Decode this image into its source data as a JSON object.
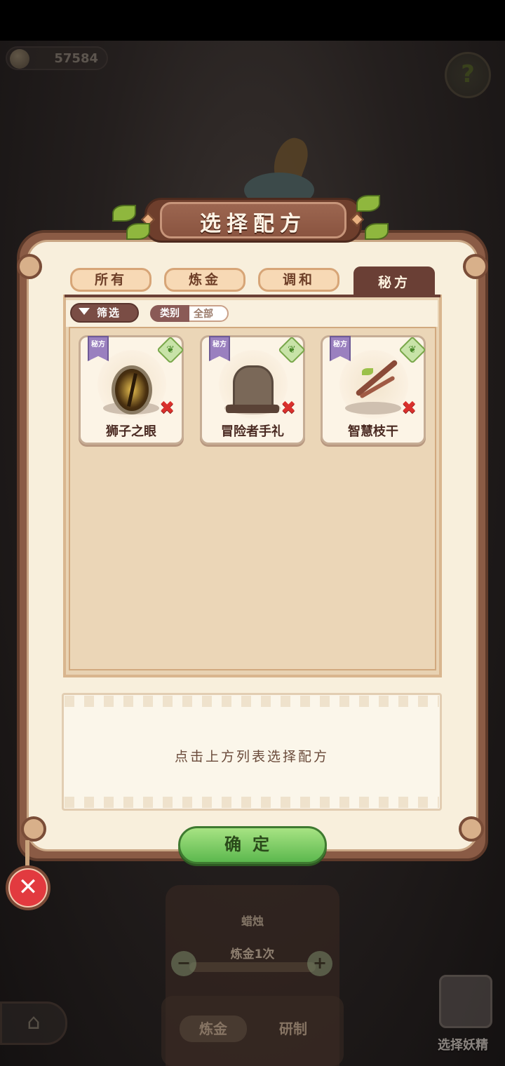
{
  "hud": {
    "coins": "57584"
  },
  "dialog": {
    "title": "选择配方",
    "tabs": [
      {
        "label": "所有",
        "active": false
      },
      {
        "label": "炼金",
        "active": false
      },
      {
        "label": "调和",
        "active": false
      },
      {
        "label": "秘方",
        "active": true
      }
    ],
    "filter": {
      "button_label": "筛选",
      "category_label": "类别",
      "category_value": "全部"
    },
    "recipes": [
      {
        "name": "狮子之眼",
        "badge": "秘方",
        "icon": "lion-eye-gem-icon",
        "unavailable": true
      },
      {
        "name": "冒险者手礼",
        "badge": "秘方",
        "icon": "lion-statue-icon",
        "unavailable": true
      },
      {
        "name": "智慧枝干",
        "badge": "秘方",
        "icon": "wisdom-branch-icon",
        "unavailable": true
      }
    ],
    "hint": "点击上方列表选择配方",
    "confirm_label": "确定"
  },
  "background": {
    "candle_label": "蜡烛",
    "alchemy_count_label": "炼金1次",
    "bottom_tabs": [
      "炼金",
      "研制"
    ],
    "select_fairy_label": "选择妖精"
  },
  "colors": {
    "panel_bg": "#f8efdc",
    "frame": "#8a5b45",
    "active_tab": "#6a3f35",
    "confirm_green": "#5cb84e",
    "close_red": "#e23a3f"
  }
}
